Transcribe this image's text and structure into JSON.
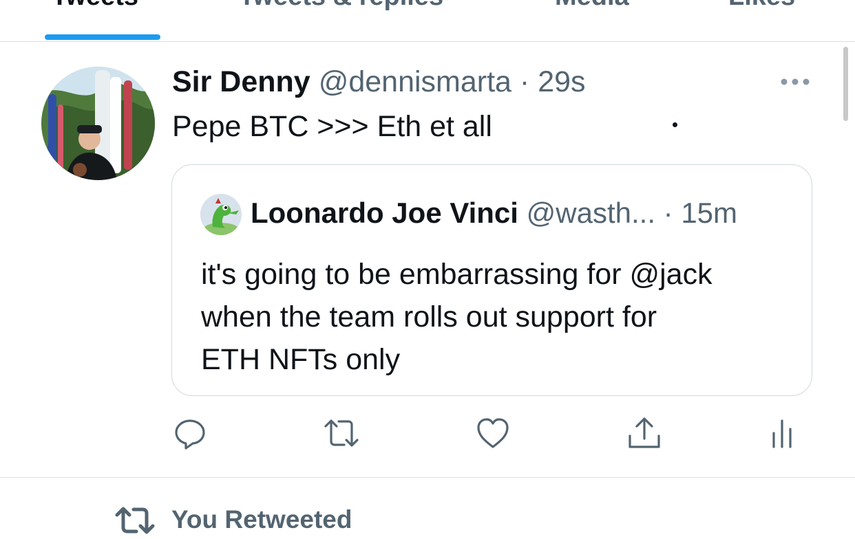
{
  "tabs": [
    {
      "label": "Tweets",
      "active": true
    },
    {
      "label": "Tweets & replies",
      "active": false
    },
    {
      "label": "Media",
      "active": false
    },
    {
      "label": "Likes",
      "active": false
    }
  ],
  "tweet": {
    "display_name": "Sir Denny",
    "handle": "@dennismarta",
    "separator": "·",
    "time": "29s",
    "text": "Pepe BTC >>> Eth et all",
    "more_icon": "more-horizontal-icon"
  },
  "quoted_tweet": {
    "display_name": "Loonardo Joe Vinci",
    "handle": "@wasth...",
    "separator": "·",
    "time": "15m",
    "text_lines": [
      "it's going to be embarrassing for @jack",
      "when the team rolls out support for",
      "ETH NFTs only"
    ]
  },
  "actions": {
    "reply_icon": "reply-icon",
    "retweet_icon": "retweet-icon",
    "like_icon": "heart-icon",
    "share_icon": "share-icon",
    "analytics_icon": "analytics-icon"
  },
  "next_tweet": {
    "social_context": "You Retweeted"
  },
  "colors": {
    "accent": "#1d9bf0",
    "text_primary": "#0f1419",
    "text_secondary": "#536471",
    "border": "#cfd9de"
  }
}
